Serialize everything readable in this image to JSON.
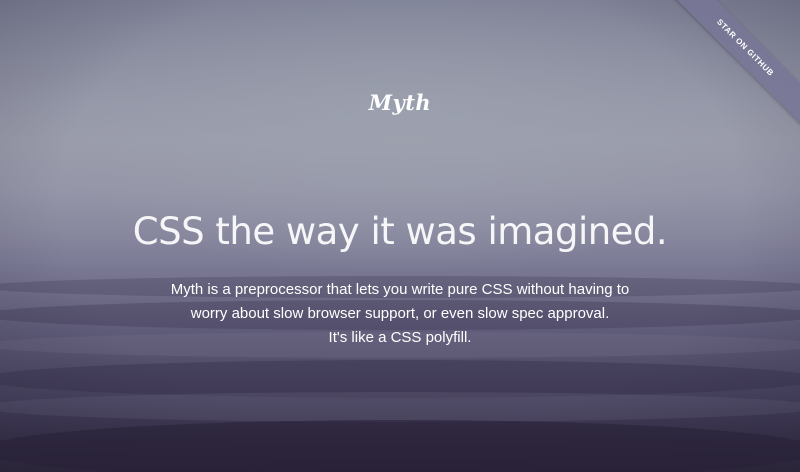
{
  "header": {
    "logo_text": "Myth",
    "github_ribbon_label": "STAR ON GITHUB"
  },
  "hero": {
    "headline": "CSS the way it was imagined.",
    "description_lines": [
      "Myth is a preprocessor that lets you write pure CSS without having to",
      "worry about slow browser support, or even slow spec approval.",
      "It's like a CSS polyfill."
    ]
  },
  "colors": {
    "text": "#ffffff",
    "ribbon": "#787696",
    "sky": "#9a9cab",
    "sea_dark": "#2c2539"
  }
}
